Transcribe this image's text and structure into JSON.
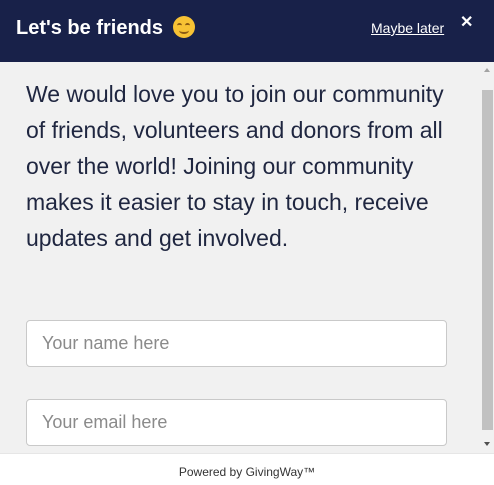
{
  "header": {
    "title": "Let's be friends",
    "emoji_icon": "smiling-face-emoji",
    "maybe_later": "Maybe later",
    "close_icon": "✕",
    "background": "#182149"
  },
  "content": {
    "description": "We would love you to join our community of friends, volunteers and donors from all over the world! Joining our community makes it easier to stay in touch, receive updates and get involved.",
    "name_placeholder": "Your name here",
    "email_placeholder": "Your email here"
  },
  "footer": {
    "powered_by": "Powered by GivingWay™"
  }
}
